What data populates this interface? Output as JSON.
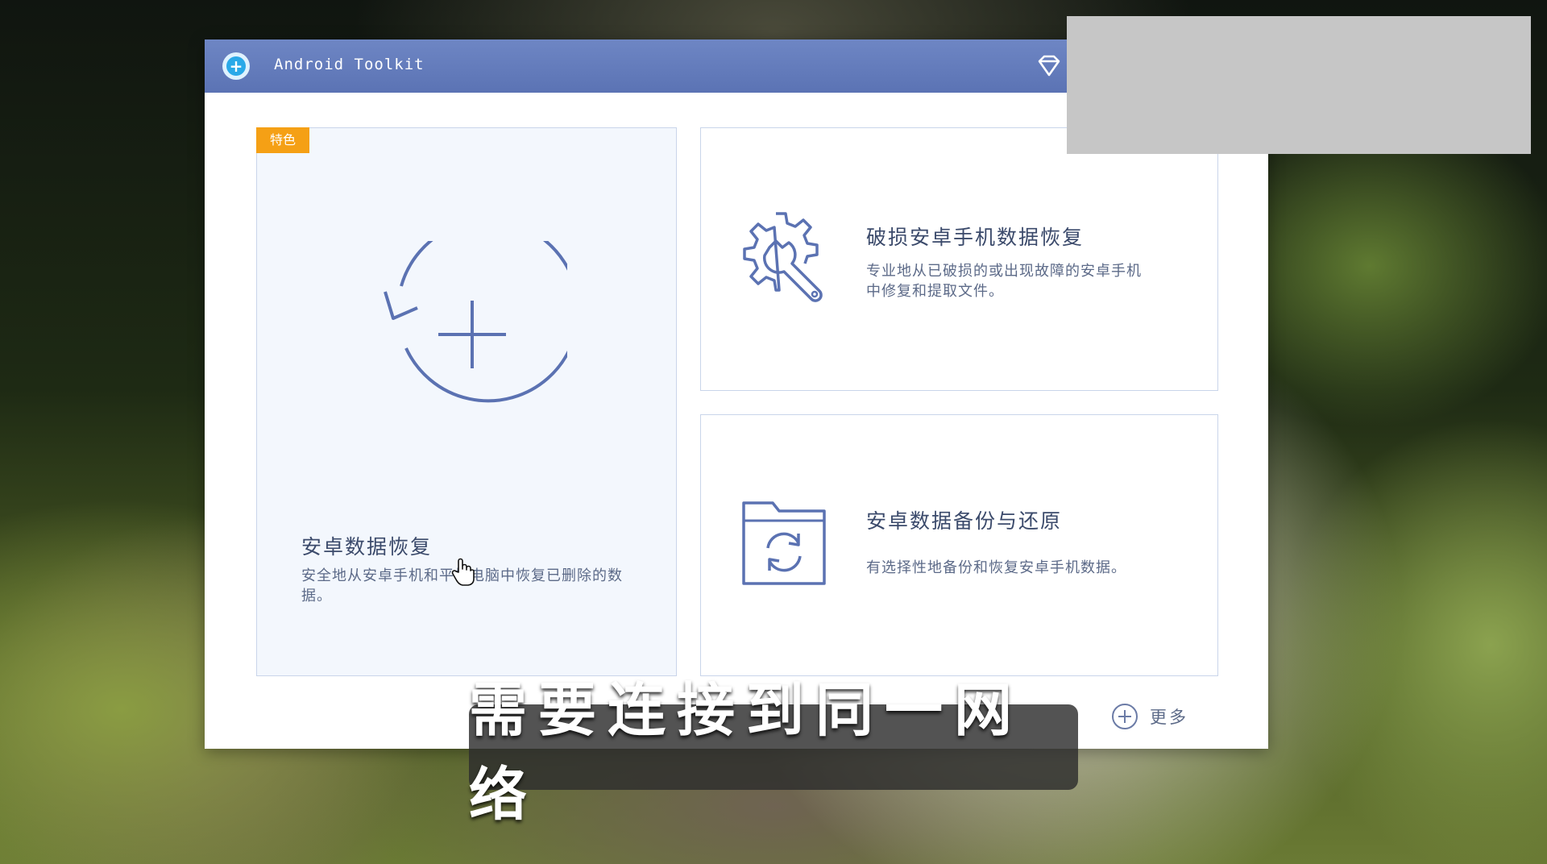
{
  "window": {
    "title": "Android Toolkit",
    "icons": {
      "logo": "android-toolkit-logo-icon",
      "premium": "diamond-icon"
    }
  },
  "cards": {
    "featured": {
      "badge": "特色",
      "title": "安卓数据恢复",
      "description": "安全地从安卓手机和平板电脑中恢复已删除的数据。",
      "icon": "recover-circle-plus-icon"
    },
    "broken_recovery": {
      "title": "破损安卓手机数据恢复",
      "description": "专业地从已破损的或出现故障的安卓手机中修复和提取文件。",
      "icon": "gear-wrench-icon"
    },
    "backup_restore": {
      "title": "安卓数据备份与还原",
      "description": "有选择性地备份和恢复安卓手机数据。",
      "icon": "folder-sync-icon"
    }
  },
  "more": {
    "label": "更多",
    "icon": "plus-circle-icon"
  },
  "subtitle": "需要连接到同一网络",
  "colors": {
    "titlebar": "#5b73b4",
    "accent_icon": "#5b72b2",
    "badge": "#f5a015",
    "card_border": "#c9d5ea",
    "featured_bg": "#f3f7fd"
  }
}
